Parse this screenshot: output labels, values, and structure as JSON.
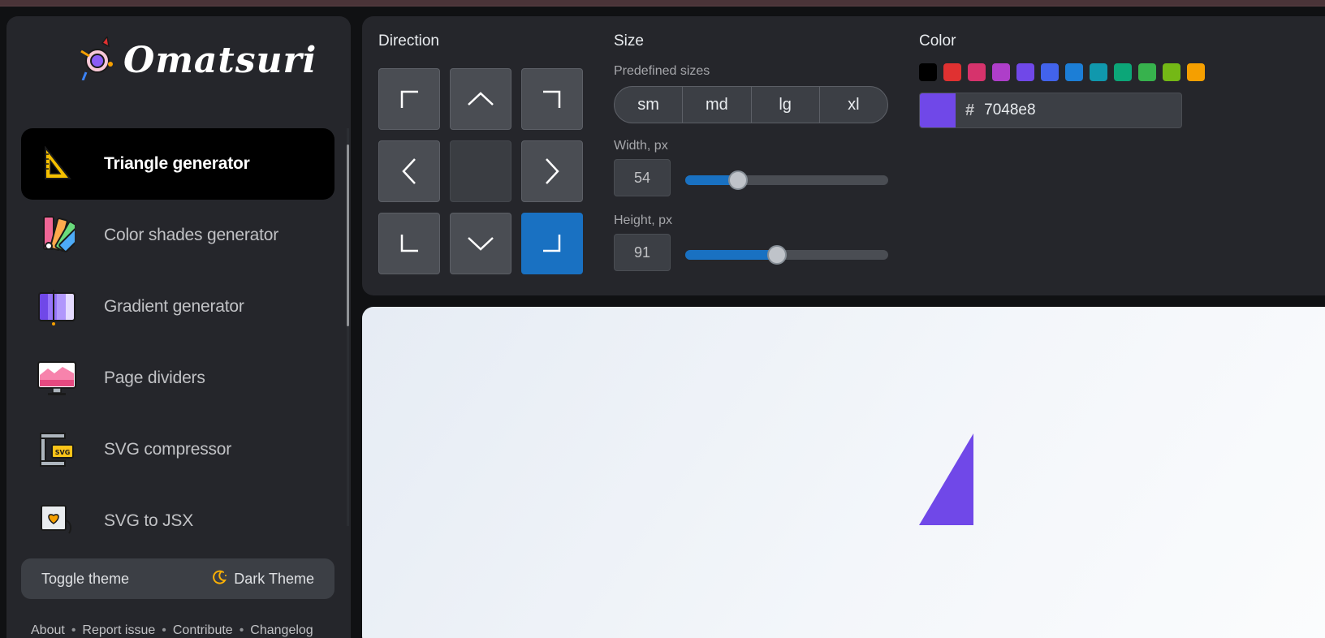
{
  "app": {
    "name": "Omatsuri"
  },
  "sidebar": {
    "items": [
      {
        "label": "Triangle generator",
        "icon": "set-square-icon",
        "active": true
      },
      {
        "label": "Color shades generator",
        "icon": "color-palette-icon",
        "active": false
      },
      {
        "label": "Gradient generator",
        "icon": "gradient-icon",
        "active": false
      },
      {
        "label": "Page dividers",
        "icon": "monitor-icon",
        "active": false
      },
      {
        "label": "SVG compressor",
        "icon": "svg-press-icon",
        "active": false
      },
      {
        "label": "SVG to JSX",
        "icon": "svg-heart-icon",
        "active": false
      }
    ],
    "toggle_label": "Toggle theme",
    "theme_label": "Dark Theme",
    "footer_links": [
      "About",
      "Report issue",
      "Contribute",
      "Changelog"
    ]
  },
  "controls": {
    "direction": {
      "title": "Direction",
      "options": [
        "top-left",
        "top",
        "top-right",
        "left",
        "center",
        "right",
        "bottom-left",
        "bottom",
        "bottom-right"
      ],
      "selected": "bottom-right"
    },
    "size": {
      "title": "Size",
      "predefined_label": "Predefined sizes",
      "predefined": [
        "sm",
        "md",
        "lg",
        "xl"
      ],
      "width_label": "Width, px",
      "width_value": "54",
      "width_fraction": 0.26,
      "height_label": "Height, px",
      "height_value": "91",
      "height_fraction": 0.45
    },
    "color": {
      "title": "Color",
      "hash": "#",
      "value": "7048e8",
      "preview": "#7048e8",
      "swatches": [
        "#000000",
        "#e03131",
        "#d6336c",
        "#ae3ec9",
        "#7048e8",
        "#4263eb",
        "#1c7ed6",
        "#1098ad",
        "#0ca678",
        "#37b24d",
        "#74b816",
        "#f59f00"
      ]
    }
  },
  "preview": {
    "triangle_color": "#7048e8"
  }
}
